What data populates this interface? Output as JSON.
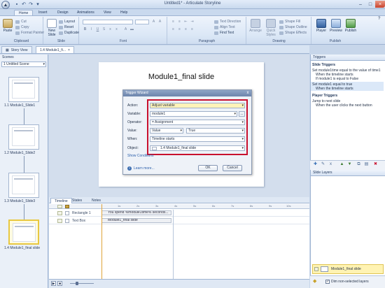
{
  "window": {
    "title": "Untitled1* - Articulate Storyline",
    "orb": "▲"
  },
  "ribbon": {
    "tabs": [
      "Home",
      "Insert",
      "Design",
      "Animations",
      "View",
      "Help"
    ],
    "groups": {
      "clipboard": {
        "label": "Clipboard",
        "paste": "Paste",
        "cut": "Cut",
        "copy": "Copy",
        "format_painter": "Format Painter"
      },
      "slide": {
        "label": "Slide",
        "new_slide": "New Slide",
        "layout": "Layout",
        "reset": "Reset",
        "duplicate": "Duplicate"
      },
      "font": {
        "label": "Font"
      },
      "paragraph": {
        "label": "Paragraph",
        "text_direction": "Text Direction",
        "align_text": "Align Text",
        "find_text": "Find Text"
      },
      "drawing": {
        "label": "Drawing",
        "arrange": "Arrange",
        "quick_styles": "Quick Styles",
        "shape_fill": "Shape Fill",
        "shape_outline": "Shape Outline",
        "shape_effects": "Shape Effects"
      },
      "publish": {
        "label": "Publish",
        "player": "Player",
        "preview": "Preview",
        "publish": "Publish"
      }
    }
  },
  "doc_tabs": [
    "Story View",
    "1.4 Module1_fi..."
  ],
  "scenes": {
    "header": "Scenes",
    "selected_scene": "1 Untitled Scene",
    "slides": [
      "1.1 Module1_Slide1",
      "1.2 Module1_Slide2",
      "1.3 Module1_Slide3",
      "1.4 Module1_final slide"
    ]
  },
  "slide": {
    "title": "Module1_final slide"
  },
  "wizard": {
    "title": "Trigger Wizard",
    "close": "x",
    "rows": [
      {
        "label": "Action:",
        "value": "Adjust variable"
      },
      {
        "label": "Variable:",
        "value": "module1"
      },
      {
        "label": "Operator:",
        "value": "= Assignment"
      },
      {
        "label": "Value:",
        "value": "Value",
        "value2": "True"
      },
      {
        "label": "When:",
        "value": "Timeline starts"
      },
      {
        "label": "Object:",
        "value": "1.4 Module1_final slide"
      }
    ],
    "var_button": "...",
    "show_conditions": "Show Conditions",
    "learn_more": "Learn more...",
    "info_icon": "i",
    "ok": "OK",
    "cancel": "Cancel"
  },
  "timeline": {
    "tabs": [
      "Timeline",
      "States",
      "Notes"
    ],
    "ticks": [
      "1s",
      "2s",
      "3s",
      "4s",
      "5s",
      "6s",
      "7s",
      "8s",
      "9s",
      "10s"
    ],
    "rows": [
      {
        "name": "Rectangle 1",
        "bar": "You spend %module1time% seconds..."
      },
      {
        "name": "Text Box",
        "bar": "Module1_final slide"
      }
    ]
  },
  "triggers": {
    "header": "Triggers",
    "slide_triggers": "Slide Triggers",
    "lines": [
      "Set module1time equal to the value of time1",
      "When the timeline starts",
      "If module1 is equal to False",
      "Set module1 equal to true",
      "When the timeline starts"
    ],
    "player_triggers": "Player Triggers",
    "jump_line": "Jump to next slide",
    "jump_when": "When the user clicks the next button"
  },
  "layers": {
    "header": "Slide Layers",
    "base_layer": "Module1_final slide",
    "dim_label": "Dim non-selected layers",
    "dim_checked": "✓"
  },
  "colors": {
    "accent_red": "#c8102e",
    "selected_yellow": "#fff3b3"
  }
}
